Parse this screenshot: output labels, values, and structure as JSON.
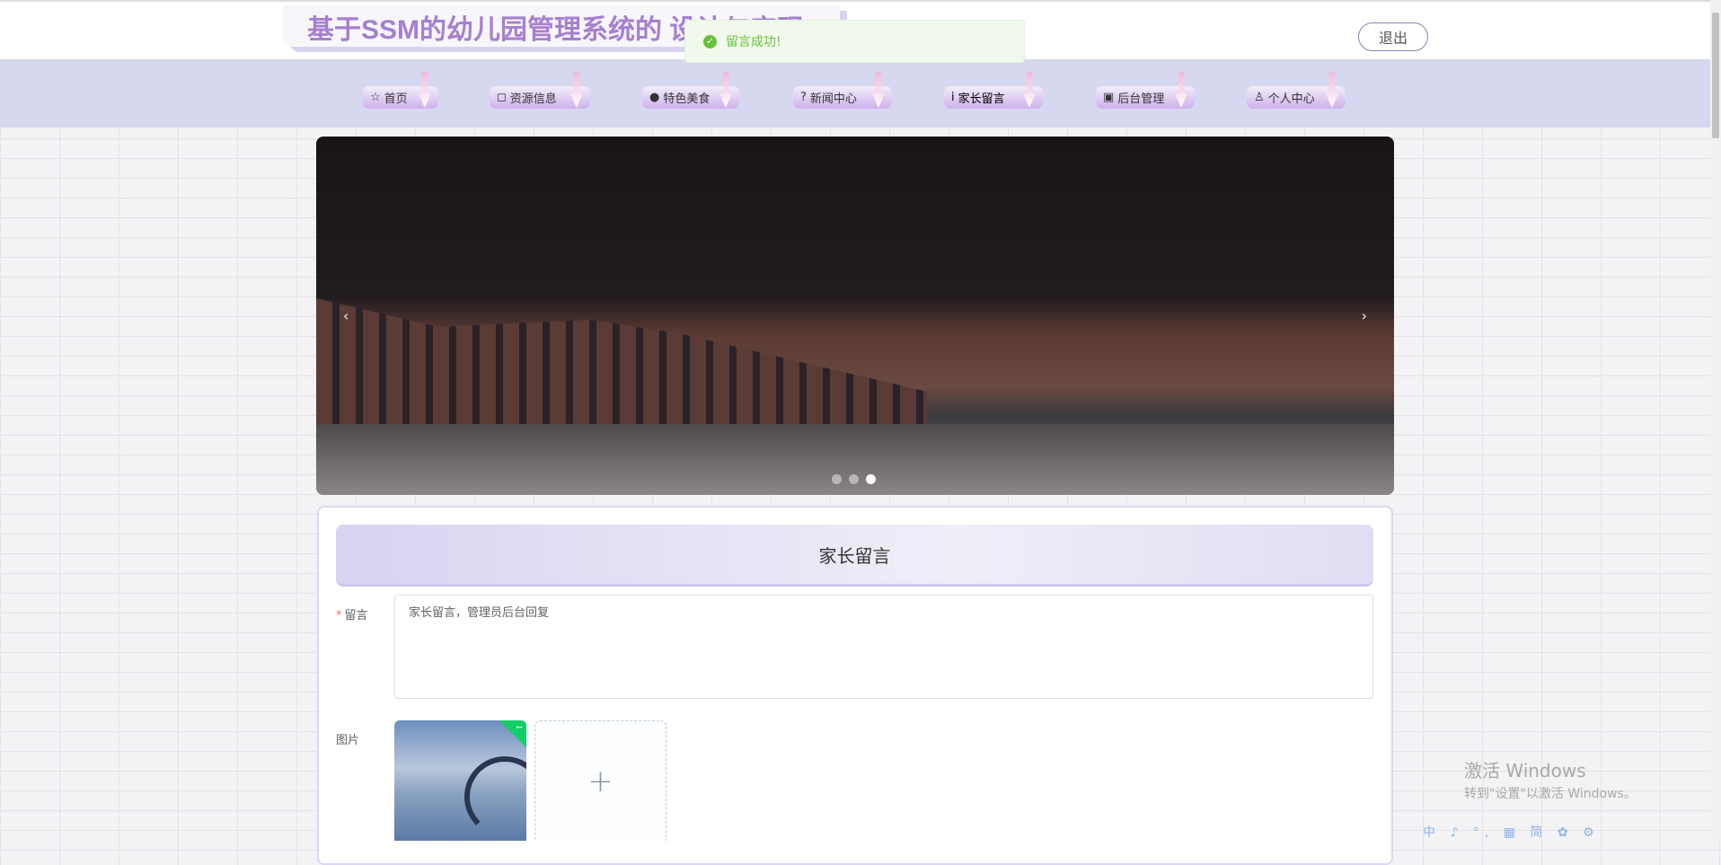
{
  "header": {
    "title": "基于SSM的幼儿园管理系统的 设计与实现",
    "logout_label": "退出"
  },
  "toast": {
    "message": "留言成功!"
  },
  "nav": [
    {
      "label": "首页",
      "icon": "☆"
    },
    {
      "label": "资源信息",
      "icon": "◻"
    },
    {
      "label": "特色美食",
      "icon": "●"
    },
    {
      "label": "新闻中心",
      "icon": "?"
    },
    {
      "label": "家长留言",
      "icon": "i"
    },
    {
      "label": "后台管理",
      "icon": "▣"
    },
    {
      "label": "个人中心",
      "icon": "♙"
    }
  ],
  "carousel": {
    "prev": "‹",
    "next": "›",
    "active_index": 2,
    "count": 3
  },
  "form": {
    "heading": "家长留言",
    "message_label": "留言",
    "required_mark": "*",
    "message_value": "家长留言，管理员后台回复",
    "image_label": "图片",
    "upload_plus": "+"
  },
  "watermark": {
    "line1": "激活 Windows",
    "line2": "转到\"设置\"以激活 Windows。"
  },
  "tray": {
    "text": "中 ♪ °, ▦ 简 ✿ ⚙"
  }
}
